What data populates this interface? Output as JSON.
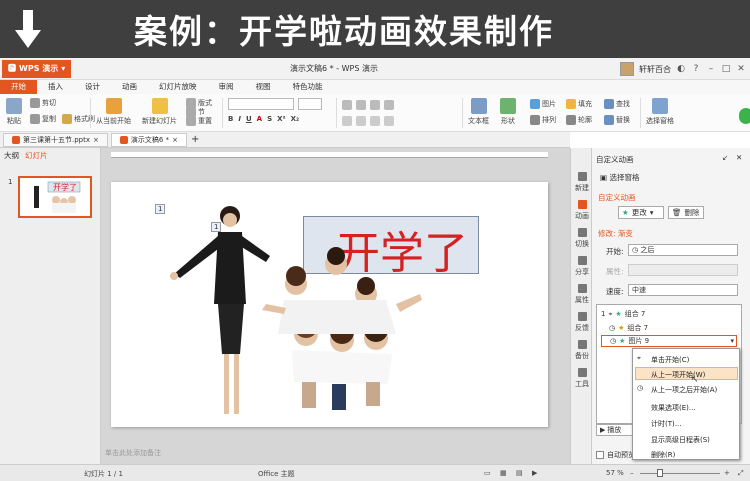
{
  "banner": {
    "title": "案例：开学啦动画效果制作"
  },
  "app": {
    "wps_button": "WPS 演示",
    "doc_title": "演示文稿6 * - WPS 演示",
    "user_name": "轩轩百合"
  },
  "menu": {
    "tabs": [
      "开始",
      "插入",
      "设计",
      "动画",
      "幻灯片放映",
      "审阅",
      "视图",
      "特色功能"
    ],
    "active": "开始"
  },
  "ribbon": {
    "paste": "粘贴",
    "cut": "剪切",
    "copy": "复制",
    "format_painter": "格式刷",
    "from_current": "从当前开始",
    "new_slide": "新建幻灯片",
    "layout": "版式",
    "section": "节",
    "reset": "重置",
    "textbox": "文本框",
    "shape": "形状",
    "picture": "图片",
    "arrange": "排列",
    "fill": "填充",
    "outline": "轮廓",
    "find": "查找",
    "replace": "替换",
    "select_pane": "选择窗格"
  },
  "doc_tabs": [
    "第三课第十五节.pptx",
    "演示文稿6 *"
  ],
  "left_pane": {
    "tab_outline": "大纲",
    "tab_slides": "幻灯片",
    "slide_number": "1"
  },
  "slide": {
    "headline": "开学了",
    "anim_tags": [
      "1",
      "1"
    ],
    "notes_placeholder": "单击此处添加备注"
  },
  "icon_strip": [
    "新建",
    "动画",
    "切换",
    "分享",
    "属性",
    "反馈",
    "备份",
    "工具"
  ],
  "task_pane": {
    "header": "自定义动画",
    "select_pane": "选择窗格",
    "section_title": "自定义动画",
    "change_button": "更改",
    "delete_button": "删除",
    "modify_label": "修改: 渐变",
    "start_label": "开始:",
    "start_value": "之后",
    "property_label": "属性:",
    "speed_label": "速度:",
    "speed_value": "中速",
    "list_items": [
      {
        "num": "1",
        "label": "组合 7"
      },
      {
        "num": "",
        "label": "组合 7"
      },
      {
        "num": "",
        "label": "图片 9"
      }
    ],
    "play_button": "播放",
    "auto_preview": "自动预览"
  },
  "context_menu": {
    "items": [
      "单击开始(C)",
      "从上一项开始(W)",
      "从上一项之后开始(A)",
      "效果选项(E)...",
      "计时(T)...",
      "显示高级日程表(S)",
      "删除(R)"
    ],
    "highlighted": 1
  },
  "status_bar": {
    "slide_info": "幻灯片 1 / 1",
    "theme": "Office 主题",
    "zoom": "57 %"
  },
  "colors": {
    "accent": "#e2561f",
    "banner_bg": "#3f3f3f",
    "headline": "#d42222"
  }
}
